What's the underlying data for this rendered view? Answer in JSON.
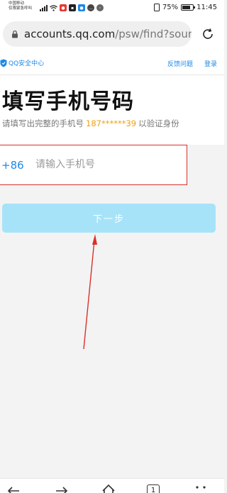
{
  "status_bar": {
    "carrier_line1": "中国移动",
    "carrier_line2": "仅限紧急呼叫",
    "battery": "75%",
    "time": "11:45"
  },
  "browser": {
    "url_domain": "accounts.qq.com",
    "url_path": "/psw/find?source"
  },
  "header": {
    "logo_text": "QQ安全中心",
    "feedback_link": "反馈问题",
    "login_link": "登录"
  },
  "page": {
    "title": "填写手机号码",
    "subtitle_before": "请填写出完整的手机号",
    "masked_phone": "187******39",
    "subtitle_after": "以验证身份"
  },
  "form": {
    "country_code": "+86",
    "phone_placeholder": "请输入手机号",
    "phone_value": "",
    "next_button": "下一步"
  },
  "bottom_nav": {
    "tab_count": "1"
  },
  "colors": {
    "accent": "#1e88e5",
    "button_bg": "#a7e3f8",
    "highlight": "#f0a010",
    "annotation": "#d9312b"
  }
}
